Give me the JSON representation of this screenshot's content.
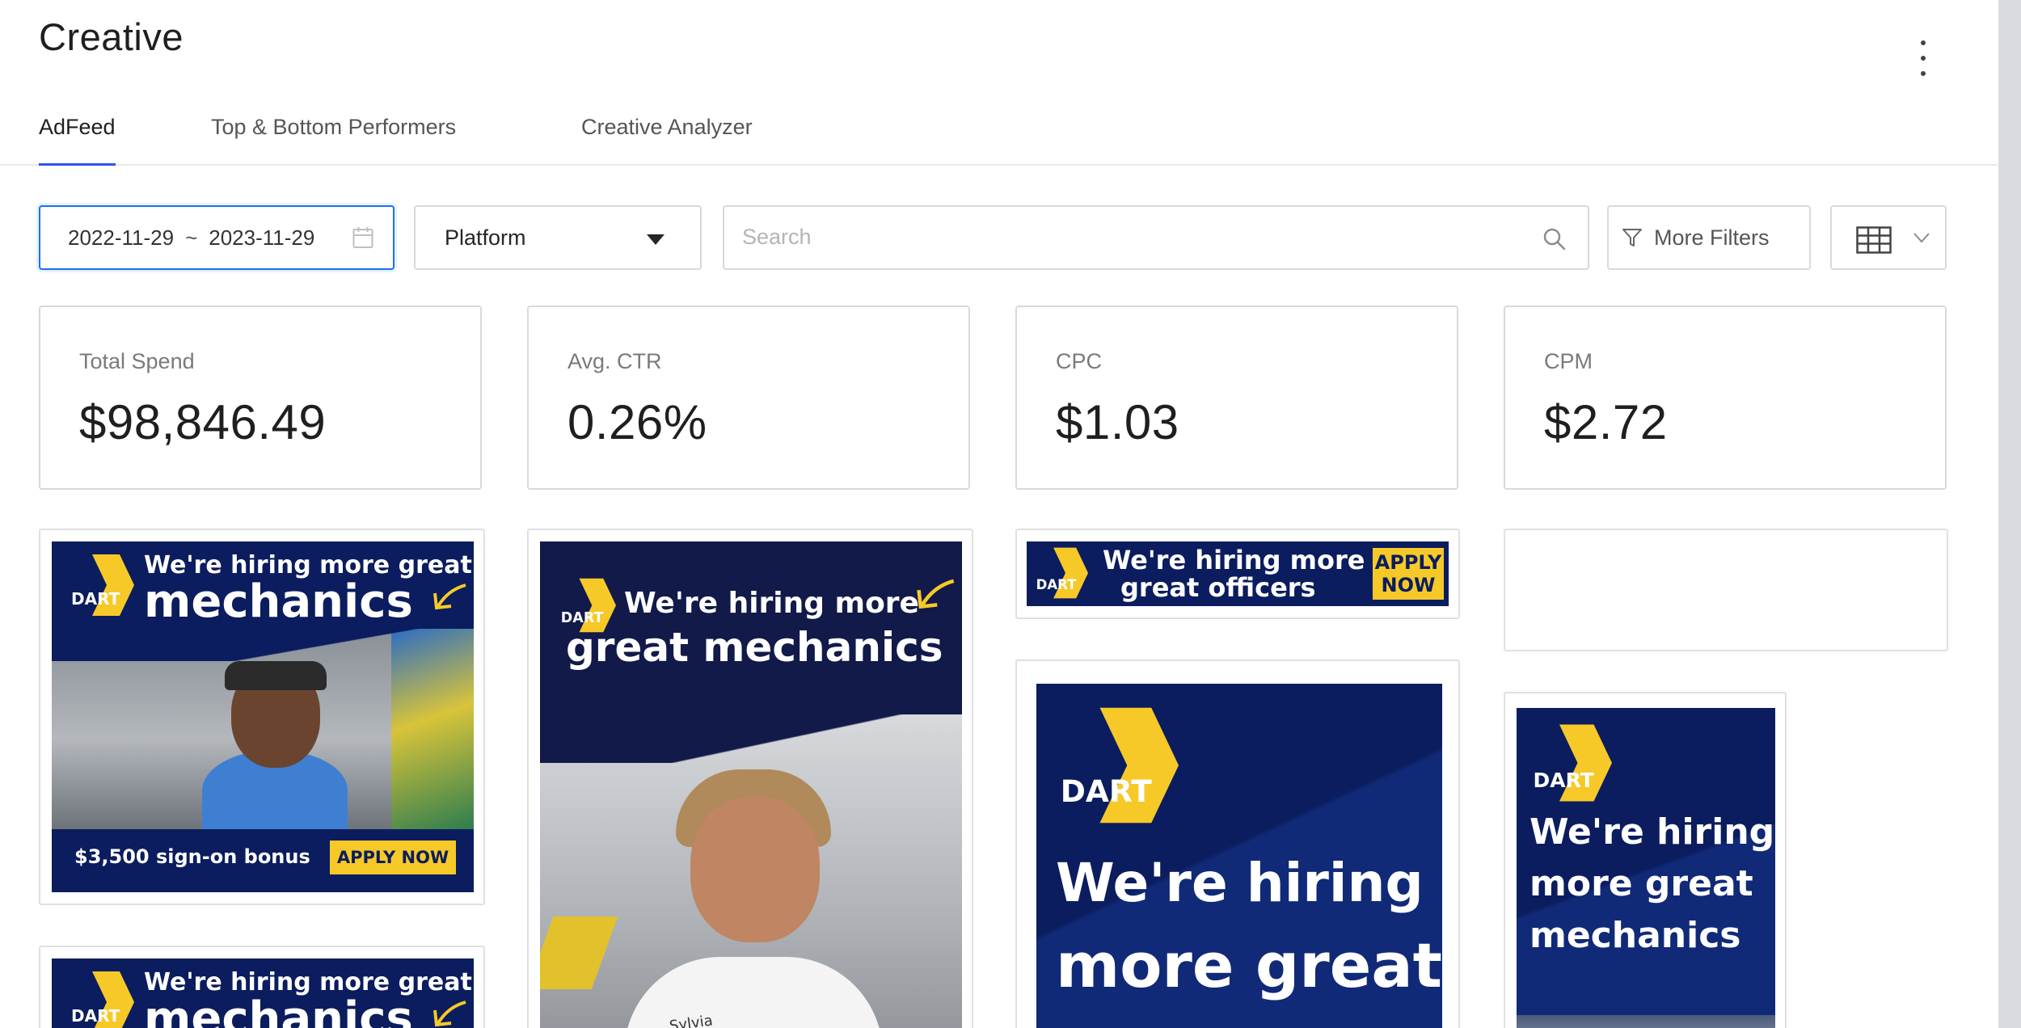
{
  "page": {
    "title": "Creative"
  },
  "tabs": [
    {
      "label": "AdFeed",
      "active": true
    },
    {
      "label": "Top & Bottom Performers",
      "active": false
    },
    {
      "label": "Creative Analyzer",
      "active": false
    }
  ],
  "filters": {
    "date_start": "2022-11-29",
    "date_separator": "~",
    "date_end": "2023-11-29",
    "platform_value": "Platform",
    "search_placeholder": "Search",
    "more_filters_label": "More Filters"
  },
  "stats": [
    {
      "label": "Total Spend",
      "value": "$98,846.49"
    },
    {
      "label": "Avg. CTR",
      "value": "0.26%"
    },
    {
      "label": "CPC",
      "value": "$1.03"
    },
    {
      "label": "CPM",
      "value": "$2.72"
    }
  ],
  "ads": {
    "ad1": {
      "line1": "We're hiring more great",
      "line2": "mechanics",
      "bonus": "$3,500 sign-on bonus",
      "cta": "APPLY NOW",
      "logo": "DART"
    },
    "ad2": {
      "line1": "We're hiring more",
      "line2": "great mechanics",
      "name_tag": "Sylvia",
      "logo": "DART"
    },
    "ad3": {
      "line1": "We're hiring more",
      "line2": "great officers",
      "cta_line1": "APPLY",
      "cta_line2": "NOW",
      "logo": "DART"
    },
    "ad4": {
      "line1": "We're hiring",
      "line2": "more great",
      "logo": "DART"
    },
    "ad5": {
      "line1": "We're hiring",
      "line2": "more great",
      "line3": "mechanics",
      "logo": "DART"
    },
    "ad6": {
      "line1": "We're hiring more great",
      "line2": "mechanics",
      "logo": "DART"
    }
  },
  "colors": {
    "accent": "#2f54eb",
    "ad_navy": "#0b1d5e",
    "ad_yellow": "#f6c928"
  },
  "icons": [
    "kebab-menu-icon",
    "calendar-icon",
    "caret-down-icon",
    "search-icon",
    "funnel-icon",
    "table-grid-icon",
    "chevron-down-icon"
  ]
}
